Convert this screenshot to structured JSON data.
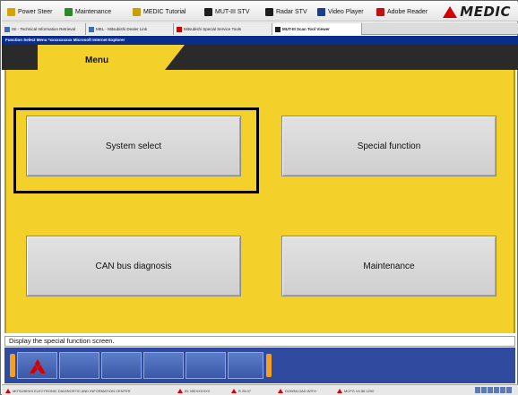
{
  "toolbar": {
    "items": [
      "Power Steer",
      "Maintenance",
      "MEDIC Tutorial",
      "MUT-III STV",
      "Radar STV",
      "Video Player",
      "Adobe Reader"
    ],
    "logo": "MEDIC",
    "icon_names": [
      "power-icon",
      "maintenance-icon",
      "tutorial-icon",
      "mut-icon",
      "radar-icon",
      "video-icon",
      "adobe-icon"
    ]
  },
  "tabs": [
    "ISI - Technical Information Retrieval",
    "MEL - Mitsubishi Dealer Link",
    "Mitsubishi Special Service Tools",
    "MUT-III Scan Tool Viewer"
  ],
  "window_title": "Function Select Menu  *xxxxxxxxxx  Microsoft Internet Explorer",
  "menu": {
    "title": "Menu",
    "buttons": {
      "system_select": "System select",
      "special_function": "Special function",
      "can_bus": "CAN bus diagnosis",
      "maintenance": "Maintenance"
    }
  },
  "status_text": "Display the special function screen.",
  "taskbar": {
    "items": [
      "MITSUBISHI ELECTRONIC DIAGNOSTIC AND INFORMATION CENTER",
      "ID: MDXXXXXX",
      "R 26.07",
      "DOWNLOAD WITH",
      "MCFG V4.58 1200"
    ]
  },
  "colors": {
    "panel_yellow": "#f3d12a",
    "fbar_blue": "#2f4a9e",
    "accent_red": "#d40000",
    "orange": "#f3a022"
  }
}
